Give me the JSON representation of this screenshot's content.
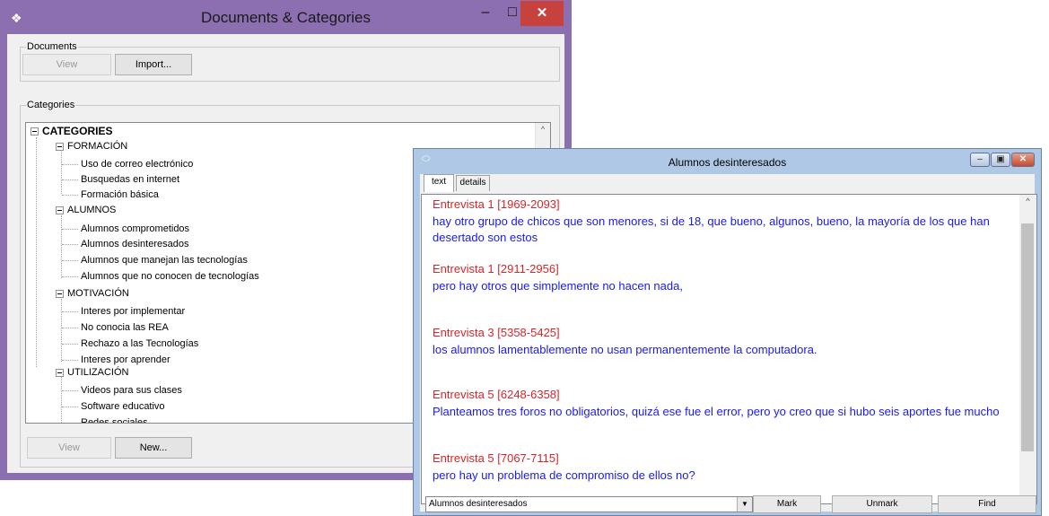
{
  "window1": {
    "title": "Documents & Categories",
    "documents_group": {
      "legend": "Documents",
      "view_label": "View",
      "import_label": "Import..."
    },
    "categories_group": {
      "legend": "Categories",
      "view_label": "View",
      "new_label": "New..."
    },
    "tree": {
      "root": "CATEGORIES",
      "groups": [
        {
          "label": "FORMACIÓN",
          "items": [
            "Uso de correo electrónico",
            "Busquedas en internet",
            "Formación básica"
          ]
        },
        {
          "label": "ALUMNOS",
          "items": [
            "Alumnos comprometidos",
            "Alumnos desinteresados",
            "Alumnos que manejan las tecnologías",
            "Alumnos que no conocen de tecnologías"
          ]
        },
        {
          "label": "MOTIVACIÓN",
          "items": [
            "Interes por implementar",
            "No conocia las REA",
            "Rechazo a las Tecnologías",
            "Interes por aprender"
          ]
        },
        {
          "label": "UTILIZACIÓN",
          "items": [
            "Videos para sus clases",
            "Software educativo",
            "Redes sociales"
          ]
        }
      ]
    }
  },
  "window2": {
    "title": "Alumnos desinteresados",
    "tabs": [
      "text",
      "details"
    ],
    "segments": [
      {
        "source": "Entrevista 1 [1969-2093]",
        "text": "hay otro grupo de chicos que son menores, si de 18, que bueno, algunos, bueno, la mayoría de los que han desertado son estos"
      },
      {
        "source": "Entrevista 1 [2911-2956]",
        "text": "pero hay otros que simplemente no hacen nada,"
      },
      {
        "source": "Entrevista 3 [5358-5425]",
        "text": "los alumnos lamentablemente no usan permanentemente la computadora."
      },
      {
        "source": "Entrevista 5 [6248-6358]",
        "text": "Planteamos tres foros no obligatorios, quizá ese fue el error, pero yo creo que si hubo seis aportes fue mucho"
      },
      {
        "source": "Entrevista 5 [7067-7115]",
        "text": " pero hay un problema de compromiso de ellos no?"
      }
    ],
    "category_select": "Alumnos desinteresados",
    "mark_label": "Mark",
    "unmark_label": "Unmark",
    "find_label": "Find"
  }
}
